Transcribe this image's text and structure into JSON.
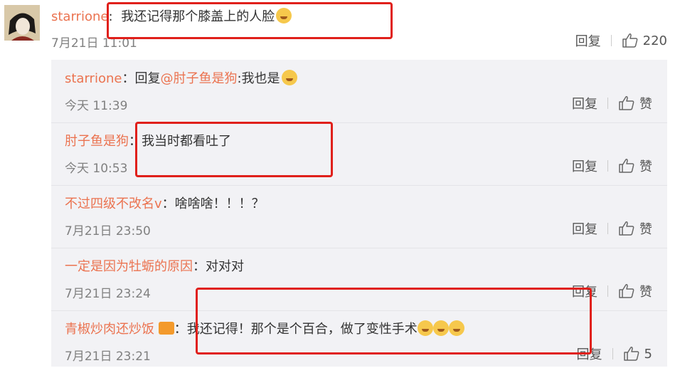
{
  "main_comment": {
    "username": "starrione",
    "separator": ":",
    "text": "我还记得那个膝盖上的人脸",
    "time": "7月21日 11:01",
    "reply_label": "回复",
    "like_count": "220"
  },
  "replies": [
    {
      "username": "starrione",
      "separator": "：",
      "prefix": "回复",
      "mention": "@肘子鱼是狗",
      "text": ":我也是",
      "time": "今天 11:39",
      "reply_label": "回复",
      "like_label": "赞"
    },
    {
      "username": "肘子鱼是狗",
      "separator": "：",
      "text": "我当时都看吐了",
      "time": "今天 10:53",
      "reply_label": "回复",
      "like_label": "赞"
    },
    {
      "username": "不过四级不改名v",
      "separator": "：",
      "text": "啥啥啥！！！？",
      "time": "7月21日 23:50",
      "reply_label": "回复",
      "like_label": "赞"
    },
    {
      "username": "一定是因为牡蛎的原因",
      "separator": "：",
      "text": "对对对",
      "time": "7月21日 23:24",
      "reply_label": "回复",
      "like_label": "赞"
    },
    {
      "username": "青椒炒肉还炒饭",
      "separator": "：",
      "text": "我还记得！那个是个百合，做了变性手术",
      "time": "7月21日 23:21",
      "reply_label": "回复",
      "like_label": "5"
    }
  ],
  "colors": {
    "username": "#eb7350",
    "annotation": "#e0201b",
    "reply_bg": "#f2f2f5"
  }
}
